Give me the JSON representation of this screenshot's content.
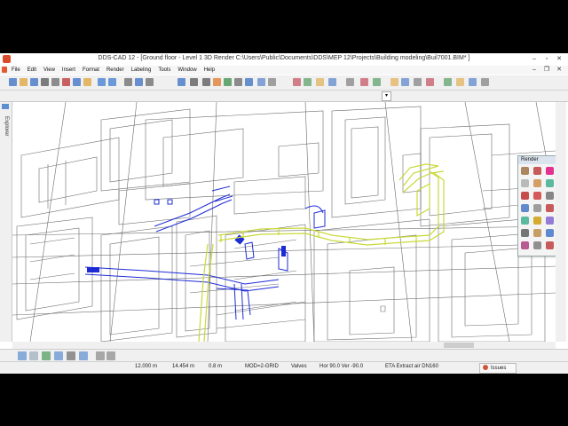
{
  "window": {
    "title": "DDS-CAD 12 - [Ground floor - Level 1  3D  Render  C:\\Users\\Public\\Documents\\DDS\\MEP 12\\Projects\\Building modeling\\Buil7001.BIM* ]"
  },
  "menu": [
    "File",
    "Edit",
    "View",
    "Insert",
    "Format",
    "Render",
    "Labeling",
    "Tools",
    "Window",
    "Help"
  ],
  "sidebar": {
    "explorer_label": "Explorer"
  },
  "render_panel": {
    "title": "Render",
    "close_glyph": "x"
  },
  "status": {
    "x": "12.000 m",
    "y": "14.454 m",
    "z": "0.8 m",
    "mode": "MOD=2-GRID",
    "layer": "Valves",
    "angles": "Hor 90.0 Ver -90.0",
    "component": "ETA Extract air DN160",
    "issues": "Issues"
  },
  "colors": {
    "duct_blue": "#1d2bd6",
    "duct_yellow": "#c9d93a",
    "wire": "#555555"
  },
  "icons": {
    "toolbar": [
      "new-icon",
      "open-icon",
      "save-icon",
      "print-icon",
      "print-preview-icon",
      "cut-icon",
      "copy-icon",
      "paste-icon",
      "undo-icon",
      "redo-icon",
      "zoom-window-icon",
      "zoom-all-icon",
      "pan-icon",
      "select-icon",
      "zoom-in-icon",
      "zoom-out-icon",
      "render-icon",
      "view-3d-icon",
      "layer-icon",
      "properties-icon"
    ],
    "bottom": [
      "snap-icon",
      "grid-icon",
      "ortho-icon",
      "object-snap-icon",
      "polar-icon",
      "tracking-icon",
      "view-icon",
      "layout-icon"
    ]
  }
}
